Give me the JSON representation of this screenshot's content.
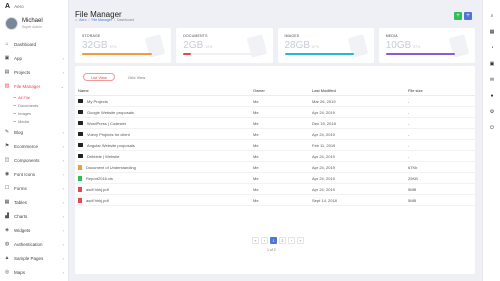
{
  "brand": {
    "logo": "A",
    "name": "Aero"
  },
  "user": {
    "name": "Michael",
    "role": "Super Admin"
  },
  "sidebar": {
    "items": [
      {
        "label": "Dashboard",
        "icon": "home-icon",
        "glyph": "⌂",
        "chev": ""
      },
      {
        "label": "App",
        "icon": "app-icon",
        "glyph": "▣",
        "chev": "›"
      },
      {
        "label": "Projects",
        "icon": "folder-icon",
        "glyph": "▤",
        "chev": "›"
      },
      {
        "label": "File Manager",
        "icon": "file-icon",
        "glyph": "▥",
        "chev": "⌄"
      }
    ],
    "subitems": [
      "All File",
      "Documents",
      "Images",
      "Media"
    ],
    "items2": [
      {
        "label": "Blog",
        "icon": "blog-icon",
        "glyph": "✎",
        "chev": "›"
      },
      {
        "label": "Ecommerce",
        "icon": "cart-icon",
        "glyph": "⚑",
        "chev": "›"
      },
      {
        "label": "Components",
        "icon": "components-icon",
        "glyph": "◫",
        "chev": "›"
      },
      {
        "label": "Font Icons",
        "icon": "font-icon",
        "glyph": "◉",
        "chev": "›"
      },
      {
        "label": "Forms",
        "icon": "forms-icon",
        "glyph": "☐",
        "chev": "›"
      },
      {
        "label": "Tables",
        "icon": "tables-icon",
        "glyph": "▦",
        "chev": "›"
      },
      {
        "label": "Charts",
        "icon": "charts-icon",
        "glyph": "▟",
        "chev": "›"
      },
      {
        "label": "Widgets",
        "icon": "widgets-icon",
        "glyph": "◈",
        "chev": "›"
      },
      {
        "label": "Authentication",
        "icon": "lock-icon",
        "glyph": "◍",
        "chev": "›"
      },
      {
        "label": "Sample Pages",
        "icon": "pages-icon",
        "glyph": "▲",
        "chev": "›"
      },
      {
        "label": "Maps",
        "icon": "map-icon",
        "glyph": "◎",
        "chev": "›"
      }
    ]
  },
  "header": {
    "title": "File Manager",
    "crumbs": [
      "Aero",
      "File Manager",
      "Dashboard"
    ],
    "btn_add": "+",
    "btn_more": "+"
  },
  "cards": [
    {
      "label": "STORAGE",
      "value": "32GB",
      "unit": "87%",
      "progress": 0.87,
      "color": "#f29b38"
    },
    {
      "label": "DOCUMENTS",
      "value": "2GB",
      "unit": "10%",
      "progress": 0.1,
      "color": "#e8474e"
    },
    {
      "label": "IMAGES",
      "value": "28GB",
      "unit": "87%",
      "progress": 0.87,
      "color": "#26b8d8"
    },
    {
      "label": "MEDIA",
      "value": "10GB",
      "unit": "87%",
      "progress": 0.87,
      "color": "#8a5ad8"
    }
  ],
  "tabs": [
    "List View",
    "Grid View"
  ],
  "table": {
    "headers": [
      "Name",
      "Owner",
      "Last Modified",
      "File size"
    ],
    "rows": [
      {
        "icon": "folder",
        "name": "My Projects",
        "owner": "Me",
        "modified": "Mar 26, 2019",
        "size": "-"
      },
      {
        "icon": "folder",
        "name": "Google Website proposals",
        "owner": "Me",
        "modified": "Apr 24, 2019",
        "size": "-"
      },
      {
        "icon": "folder",
        "name": "WordPress | Codester",
        "owner": "Me",
        "modified": "Dec 15, 2018",
        "size": "-"
      },
      {
        "icon": "folder",
        "name": "Vuexy Projects for client",
        "owner": "Me",
        "modified": "Apr 24, 2019",
        "size": "-"
      },
      {
        "icon": "folder",
        "name": "Angular Website proposals",
        "owner": "Me",
        "modified": "Feb 11, 2019",
        "size": "-"
      },
      {
        "icon": "folder",
        "name": "Dribbble | Website",
        "owner": "Me",
        "modified": "Apr 24, 2019",
        "size": "-"
      },
      {
        "icon": "doc",
        "name": "Document of Understanding",
        "owner": "Me",
        "modified": "Apr 24, 2019",
        "size": "67Kb"
      },
      {
        "icon": "xls",
        "name": "Report2016.xls",
        "owner": "Me",
        "modified": "Apr 24, 2019",
        "size": "25KB"
      },
      {
        "icon": "pdf",
        "name": "asdf hhkj.pdf",
        "owner": "Me",
        "modified": "Apr 24, 2019",
        "size": "5MB"
      },
      {
        "icon": "pdf",
        "name": "asdf hhkj.pdf",
        "owner": "Me",
        "modified": "Sept 14, 2018",
        "size": "5MB"
      }
    ]
  },
  "pagination": {
    "pages": [
      "«",
      "‹",
      "1",
      "2",
      "›",
      "»"
    ],
    "info": "1 of 2"
  }
}
